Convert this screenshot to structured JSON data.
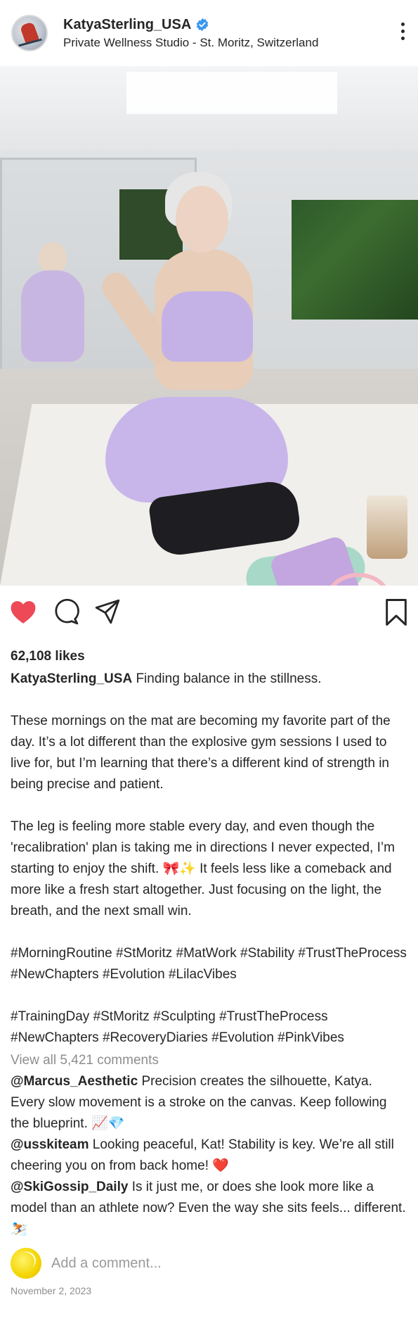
{
  "header": {
    "username": "KatyaSterling_USA",
    "location": "Private Wellness Studio - St. Moritz, Switzerland"
  },
  "colors": {
    "like_red": "#ed4956",
    "verified_blue": "#3897f0",
    "text": "#262626",
    "muted": "#8e8e8e"
  },
  "icons": {
    "verified": "verified-badge-icon",
    "more": "more-options-icon",
    "like": "heart-icon",
    "comment": "comment-icon",
    "share": "share-icon",
    "save": "bookmark-icon"
  },
  "post": {
    "likes": "62,108 likes",
    "caption_author": "KatyaSterling_USA",
    "caption_first": "Finding balance in the stillness.",
    "paragraphs": [
      "These mornings on the mat are becoming my favorite part of the day. It’s a lot different than the explosive gym sessions I used to live for, but I’m learning that there’s a different kind of strength in being precise and patient.",
      "The leg is feeling more stable every day, and even though the 'recalibration' plan is taking me in directions I never expected, I’m starting to enjoy the shift. 🎀✨ It feels less like a comeback and more like a fresh start altogether. Just focusing on the light, the breath, and the next small win.",
      "#MorningRoutine #StMoritz #MatWork #Stability #TrustTheProcess #NewChapters #Evolution #LilacVibes",
      "#TrainingDay #StMoritz #Sculpting #TrustTheProcess #NewChapters #RecoveryDiaries #Evolution #PinkVibes"
    ],
    "view_comments": "View all 5,421 comments",
    "comments": [
      {
        "author": "@Marcus_Aesthetic",
        "text": "Precision creates the silhouette, Katya. Every slow movement is a stroke on the canvas. Keep following the blueprint. 📈💎"
      },
      {
        "author": "@usskiteam",
        "text": "Looking peaceful, Kat! Stability is key. We’re all still cheering you on from back home! ❤️"
      },
      {
        "author": "@SkiGossip_Daily",
        "text": "Is it just me, or does she look more like a model than an athlete now? Even the way she sits feels... different. ⛷️"
      }
    ],
    "add_comment_placeholder": "Add a comment...",
    "date": "November 2, 2023"
  }
}
